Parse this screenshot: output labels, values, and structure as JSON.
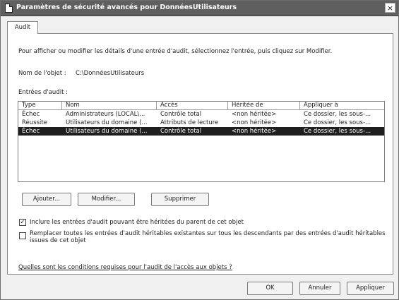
{
  "window": {
    "title": "Paramètres de sécurité avancés pour DonnéesUtilisateurs",
    "close_glyph": "×"
  },
  "tabs": [
    {
      "label": "Audit"
    }
  ],
  "audit": {
    "description": "Pour afficher ou modifier les détails d'une entrée d'audit, sélectionnez l'entrée, puis cliquez sur Modifier.",
    "object_name_label": "Nom de l'objet :",
    "object_name_value": "C:\\DonnéesUtilisateurs",
    "entries_label": "Entrées d'audit :",
    "columns": [
      "Type",
      "Nom",
      "Accès",
      "Héritée de",
      "Appliquer à"
    ],
    "rows": [
      {
        "type": "Échec",
        "name": "Administrateurs (LOCAL\\...",
        "access": "Contrôle total",
        "inherited": "<non héritée>",
        "apply": "Ce dossier, les sous-...",
        "selected": false
      },
      {
        "type": "Réussite",
        "name": "Utilisateurs du domaine (...",
        "access": "Attributs de lecture",
        "inherited": "<non héritée>",
        "apply": "Ce dossier, les sous-...",
        "selected": false
      },
      {
        "type": "Échec",
        "name": "Utilisateurs du domaine (...",
        "access": "Contrôle total",
        "inherited": "<non héritée>",
        "apply": "Ce dossier, les sous-...",
        "selected": true
      }
    ],
    "buttons": {
      "add": "Ajouter...",
      "edit": "Modifier...",
      "remove": "Supprimer"
    },
    "checkbox_include": {
      "label": "Inclure les entrées d'audit pouvant être héritées du parent de cet objet",
      "checked": true,
      "glyph": "✓"
    },
    "checkbox_replace": {
      "label": "Remplacer toutes les entrées d'audit héritables existantes sur tous les descendants par des entrées d'audit héritables issues de cet objet",
      "checked": false
    },
    "help_link": "Quelles sont les conditions requises pour l'audit de l'accès aux objets ?"
  },
  "footer": {
    "ok": "OK",
    "cancel": "Annuler",
    "apply": "Appliquer"
  }
}
